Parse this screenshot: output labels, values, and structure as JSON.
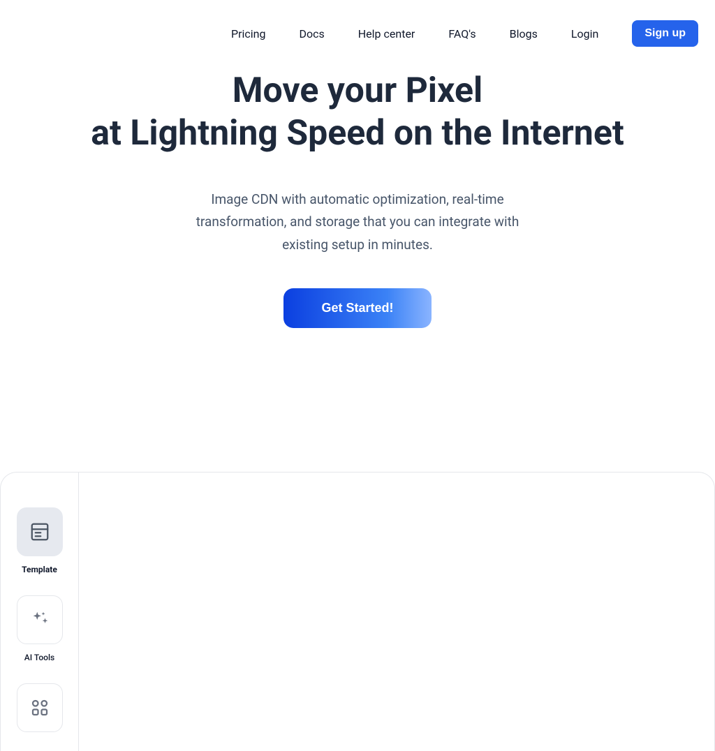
{
  "nav": {
    "items": [
      {
        "label": "Pricing"
      },
      {
        "label": "Docs"
      },
      {
        "label": "Help center"
      },
      {
        "label": "FAQ's"
      },
      {
        "label": "Blogs"
      },
      {
        "label": "Login"
      }
    ],
    "signup_label": "Sign up"
  },
  "hero": {
    "title_line1": "Move your Pixel",
    "title_line2": "at Lightning Speed on the Internet",
    "subtitle": "Image CDN with automatic optimization, real-time transformation, and storage that you can integrate with existing setup in minutes.",
    "cta_label": "Get Started!"
  },
  "sidebar": {
    "items": [
      {
        "label": "Template",
        "icon": "template-icon",
        "active": true
      },
      {
        "label": "AI Tools",
        "icon": "sparkles-icon",
        "active": false
      },
      {
        "label": "",
        "icon": "grid-icon",
        "active": false
      }
    ]
  },
  "colors": {
    "accent": "#2563eb",
    "text_dark": "#1e293b",
    "text_muted": "#475569",
    "border": "#e5e7eb"
  }
}
